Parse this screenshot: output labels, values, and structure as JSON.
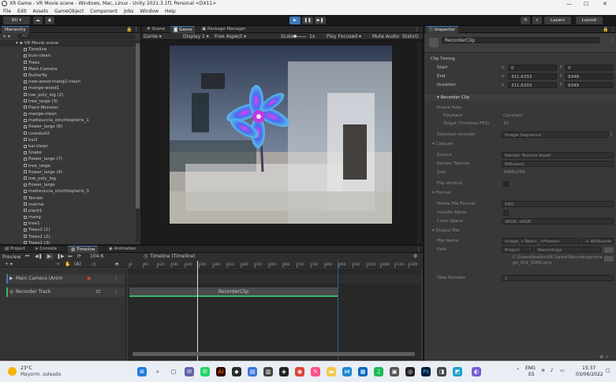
{
  "window": {
    "title": "XR Game - VR Movie scene - Windows, Mac, Linux - Unity 2021.3.1f1 Personal <DX11>",
    "min": "—",
    "max": "☐",
    "close": "✕"
  },
  "menu": [
    "File",
    "Edit",
    "Assets",
    "GameObject",
    "Component",
    "Jobs",
    "Window",
    "Help"
  ],
  "toolbar": {
    "account": "BU ▾",
    "layers": "Layers",
    "layout": "Layout"
  },
  "hierarchy": {
    "tab": "Hierarchy",
    "search_placeholder": "All",
    "scene": "VR Movie scene",
    "items": [
      "Timeline",
      "busi-clean",
      "Trees",
      "Main Camera",
      "Butterfly",
      "new-wood-mang2-clean",
      "mange-wood1",
      "low_poly_log (2)",
      "tree_large (3)",
      "Plant Monster",
      "mange-clean",
      "matteuccia_struthiopteris_1",
      "flower_large (6)",
      "cowskull2",
      "kai2",
      "kai-clean",
      "Snake",
      "flower_large (7)",
      "tree_large",
      "flower_large (4)",
      "low_poly_log",
      "flower_large",
      "matteuccia_struthiopteris_3",
      "Terrain",
      "marina",
      "plant1",
      "mang",
      "tree1",
      "Trees2 (1)",
      "Trees2 (2)",
      "Trees2 (3)"
    ]
  },
  "gameview": {
    "tabs": [
      "Scene",
      "Game",
      "Package Manager"
    ],
    "bar": {
      "mode": "Game",
      "display": "Display 1",
      "aspect": "Free Aspect",
      "scale_label": "Scale",
      "scale_value": "1x",
      "play_focused": "Play Focused",
      "mute": "Mute Audio",
      "stats": "Stats",
      "gizmos": "G"
    }
  },
  "inspector": {
    "tab": "Inspector",
    "object": "RecorderClip",
    "clip_timing": "Clip Timing",
    "timing": [
      {
        "label": "Start",
        "s": "0",
        "f": "0"
      },
      {
        "label": "End",
        "s": "311.6333",
        "f": "9349"
      },
      {
        "label": "Duration",
        "s": "311.6333",
        "f": "9349"
      }
    ],
    "recorder_clip": "Recorder Clip",
    "frame_rate": "Frame Rate",
    "playback_label": "Playback",
    "playback": "Constant",
    "target_label": "Target (Timeline FPS)",
    "target": "30",
    "selected_recorder_label": "Selected recorder",
    "selected_recorder": "Image Sequence",
    "capture": "Capture",
    "source_label": "Source",
    "source": "Render Texture Asset",
    "render_texture_label": "Render Texture",
    "render_texture": "RtExpect",
    "size_label": "Size",
    "size": "4096x256",
    "flip_label": "Flip Vertical",
    "format": "Format",
    "media_label": "Media File Format",
    "media": "PNG",
    "alpha_label": "Include Alpha",
    "color_label": "Color Space",
    "color": "sRGB, sRGB",
    "output": "Output File",
    "filename_label": "File Name",
    "filename": "image_<Take>_<Frame>",
    "wildcards": "+ Wildcards ▾",
    "path_label": "Path",
    "path_root": "Project",
    "path_folder": "Recordings",
    "path_full": "C:\\Users\\busito\\XR Game\\Recordings\\image_001_0000.png",
    "take_label": "Take Number",
    "take": "1"
  },
  "timeline": {
    "tabs": [
      "Project",
      "Console",
      "Timeline",
      "Animation"
    ],
    "preview": "Preview",
    "frame": "104.6",
    "asset": "Timeline (Timeline)",
    "ruler": [
      "0",
      "60",
      "120",
      "180",
      "240",
      "300",
      "360",
      "420",
      "480",
      "540",
      "600",
      "660",
      "720",
      "780",
      "840",
      "900",
      "960",
      "1020",
      "1080",
      "1140",
      "1200"
    ],
    "tracks": [
      {
        "name": "Main Camera (Anim",
        "clip": ""
      },
      {
        "name": "Recorder Track",
        "clip": "RecorderClip"
      }
    ]
  },
  "taskbar": {
    "weather_temp": "23°C",
    "weather_desc": "Mayorm. soleado",
    "lang": "ENG",
    "region": "ES",
    "time": "15:37",
    "date": "03/06/2022"
  }
}
